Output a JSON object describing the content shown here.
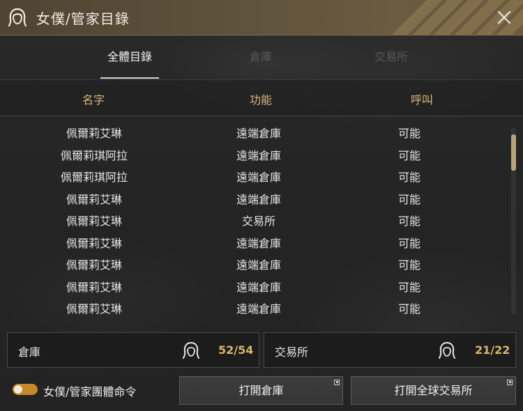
{
  "window": {
    "title": "女僕/管家目錄",
    "close_icon": "close-icon"
  },
  "tabs": [
    {
      "label": "全體目錄",
      "active": true
    },
    {
      "label": "倉庫",
      "active": false
    },
    {
      "label": "交易所",
      "active": false
    }
  ],
  "columns": {
    "name": "名字",
    "function": "功能",
    "call": "呼叫"
  },
  "rows": [
    {
      "name": "佩爾莉艾琳",
      "function": "遠端倉庫",
      "call": "可能"
    },
    {
      "name": "佩爾莉琪阿拉",
      "function": "遠端倉庫",
      "call": "可能"
    },
    {
      "name": "佩爾莉琪阿拉",
      "function": "遠端倉庫",
      "call": "可能"
    },
    {
      "name": "佩爾莉艾琳",
      "function": "遠端倉庫",
      "call": "可能"
    },
    {
      "name": "佩爾莉艾琳",
      "function": "交易所",
      "call": "可能"
    },
    {
      "name": "佩爾莉艾琳",
      "function": "遠端倉庫",
      "call": "可能"
    },
    {
      "name": "佩爾莉艾琳",
      "function": "遠端倉庫",
      "call": "可能"
    },
    {
      "name": "佩爾莉艾琳",
      "function": "遠端倉庫",
      "call": "可能"
    },
    {
      "name": "佩爾莉艾琳",
      "function": "遠端倉庫",
      "call": "可能"
    }
  ],
  "counters": {
    "warehouse": {
      "label": "倉庫",
      "count": "52/54"
    },
    "market": {
      "label": "交易所",
      "count": "21/22"
    }
  },
  "footer": {
    "toggle_label": "女僕/管家團體命令",
    "toggle_on": true,
    "open_warehouse": "打開倉庫",
    "open_market": "打開全球交易所"
  },
  "colors": {
    "accent_gold": "#d9b66b",
    "header_gold": "#d7b97e",
    "toggle_orange": "#c9872c",
    "titlebar": "#5f523c"
  }
}
